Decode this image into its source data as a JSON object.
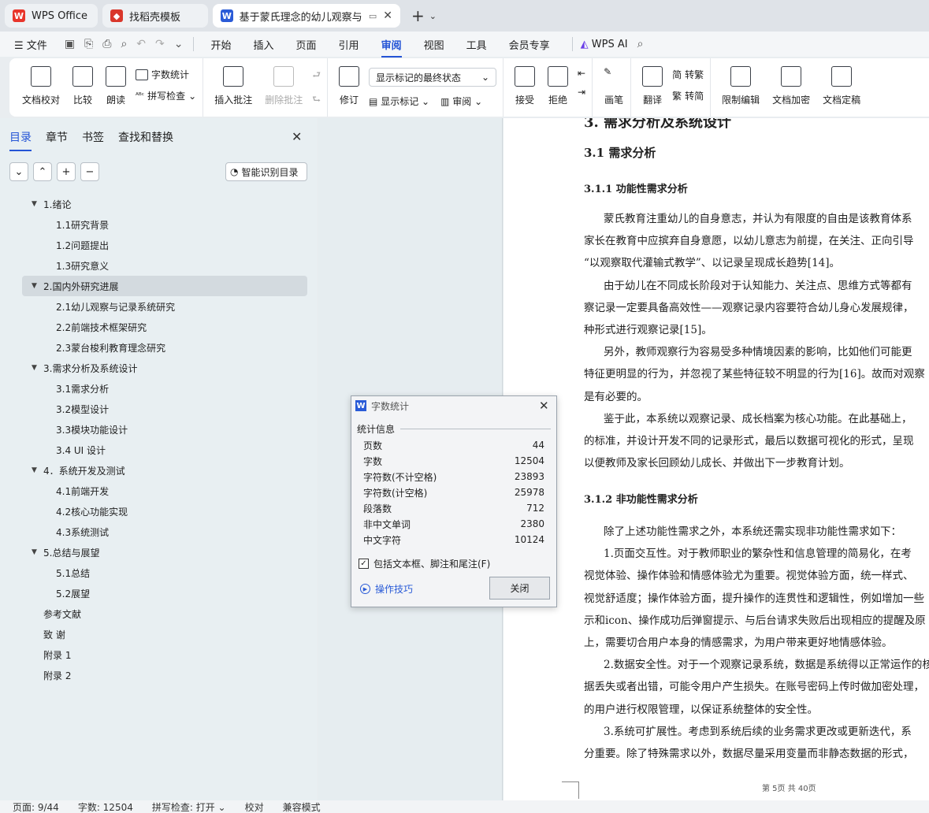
{
  "tabs": [
    {
      "label": "WPS Office",
      "color": "#e8352b"
    },
    {
      "label": "找稻壳模板",
      "color": "#d9372b"
    },
    {
      "label": "基于蒙氏理念的幼儿观察与记录",
      "color": "#2a5bd7"
    }
  ],
  "menu": {
    "file": "文件",
    "items": [
      "开始",
      "插入",
      "页面",
      "引用",
      "审阅",
      "视图",
      "工具",
      "会员专享"
    ],
    "active": "审阅",
    "ai": "WPS AI"
  },
  "ribbon": {
    "doc_check": "文档校对",
    "compare": "比较",
    "read_aloud": "朗读",
    "word_count": "字数统计",
    "spell_check": "拼写检查",
    "insert_comment": "插入批注",
    "delete_comment": "删除批注",
    "revise": "修订",
    "markup_dropdown": "显示标记的最终状态",
    "show_markup": "显示标记",
    "review": "审阅",
    "accept": "接受",
    "reject": "拒绝",
    "pen": "画笔",
    "translate": "翻译",
    "to_traditional": "转繁",
    "to_simplified": "转简",
    "restrict_edit": "限制编辑",
    "doc_encrypt": "文档加密",
    "doc_final": "文档定稿"
  },
  "panel": {
    "tabs": [
      "目录",
      "章节",
      "书签",
      "查找和替换"
    ],
    "smart_toc": "智能识别目录",
    "toc": [
      {
        "label": "1.绪论",
        "level": 1,
        "caret": true
      },
      {
        "label": "1.1研究背景",
        "level": 2
      },
      {
        "label": "1.2问题提出",
        "level": 2
      },
      {
        "label": "1.3研究意义",
        "level": 2
      },
      {
        "label": "2.国内外研究进展",
        "level": 1,
        "caret": true,
        "selected": true
      },
      {
        "label": "2.1幼儿观察与记录系统研究",
        "level": 2
      },
      {
        "label": "2.2前端技术框架研究",
        "level": 2
      },
      {
        "label": "2.3蒙台梭利教育理念研究",
        "level": 2
      },
      {
        "label": "3.需求分析及系统设计",
        "level": 1,
        "caret": true
      },
      {
        "label": "3.1需求分析",
        "level": 2
      },
      {
        "label": "3.2模型设计",
        "level": 2
      },
      {
        "label": "3.3模块功能设计",
        "level": 2
      },
      {
        "label": "3.4 UI 设计",
        "level": 2
      },
      {
        "label": "4．系统开发及测试",
        "level": 1,
        "caret": true
      },
      {
        "label": "4.1前端开发",
        "level": 2
      },
      {
        "label": "4.2核心功能实现",
        "level": 2
      },
      {
        "label": "4.3系统测试",
        "level": 2
      },
      {
        "label": "5.总结与展望",
        "level": 1,
        "caret": true
      },
      {
        "label": "5.1总结",
        "level": 2
      },
      {
        "label": "5.2展望",
        "level": 2
      },
      {
        "label": "参考文献",
        "level": 1
      },
      {
        "label": "致  谢",
        "level": 1
      },
      {
        "label": "附录 1",
        "level": 1
      },
      {
        "label": "附录 2",
        "level": 1
      }
    ]
  },
  "document": {
    "h1": "3. 需求分析及系统设计",
    "h2": "3.1 需求分析",
    "h3a": "3.1.1 功能性需求分析",
    "h3b": "3.1.2 非功能性需求分析",
    "lines_a": [
      "蒙氏教育注重幼儿的自身意志，并认为有限度的自由是该教育体系",
      "家长在教育中应摈弃自身意愿，以幼儿意志为前提，在关注、正向引导",
      "“以观察取代灌输式教学”、以记录呈现成长趋势[14]。",
      "由于幼儿在不同成长阶段对于认知能力、关注点、思维方式等都有",
      "察记录一定要具备高效性——观察记录内容要符合幼儿身心发展规律，",
      "种形式进行观察记录[15]。",
      "另外，教师观察行为容易受多种情境因素的影响，比如他们可能更",
      "特征更明显的行为，并忽视了某些特征较不明显的行为[16]。故而对观察",
      "是有必要的。",
      "鉴于此，本系统以观察记录、成长档案为核心功能。在此基础上，",
      "的标准，并设计开发不同的记录形式，最后以数据可视化的形式，呈现",
      "以便教师及家长回顾幼儿成长、并做出下一步教育计划。"
    ],
    "lines_b": [
      "除了上述功能性需求之外，本系统还需实现非功能性需求如下：",
      "1.页面交互性。对于教师职业的繁杂性和信息管理的简易化，在考",
      "视觉体验、操作体验和情感体验尤为重要。视觉体验方面，统一样式、",
      "视觉舒适度；操作体验方面，提升操作的连贯性和逻辑性，例如增加一些",
      "示和icon、操作成功后弹窗提示、与后台请求失败后出现相应的提醒及原",
      "上，需要切合用户本身的情感需求，为用户带来更好地情感体验。",
      "2.数据安全性。对于一个观察记录系统，数据是系统得以正常运作的核",
      "据丢失或者出错，可能令用户产生损失。在账号密码上传时做加密处理，",
      "的用户进行权限管理，以保证系统整体的安全性。",
      "3.系统可扩展性。考虑到系统后续的业务需求更改或更新迭代，系",
      "分重要。除了特殊需求以外，数据尽量采用变量而非静态数据的形式，"
    ],
    "footer": "第 5页    共 40页"
  },
  "dialog": {
    "title": "字数统计",
    "section": "统计信息",
    "stats": [
      {
        "label": "页数",
        "value": "44"
      },
      {
        "label": "字数",
        "value": "12504"
      },
      {
        "label": "字符数(不计空格)",
        "value": "23893"
      },
      {
        "label": "字符数(计空格)",
        "value": "25978"
      },
      {
        "label": "段落数",
        "value": "712"
      },
      {
        "label": "非中文单词",
        "value": "2380"
      },
      {
        "label": "中文字符",
        "value": "10124"
      }
    ],
    "checkbox": "包括文本框、脚注和尾注(F)",
    "tips": "操作技巧",
    "close": "关闭"
  },
  "status": {
    "page": "页面: 9/44",
    "words": "字数: 12504",
    "spell": "拼写检查: 打开",
    "proof": "校对",
    "compat": "兼容模式"
  }
}
